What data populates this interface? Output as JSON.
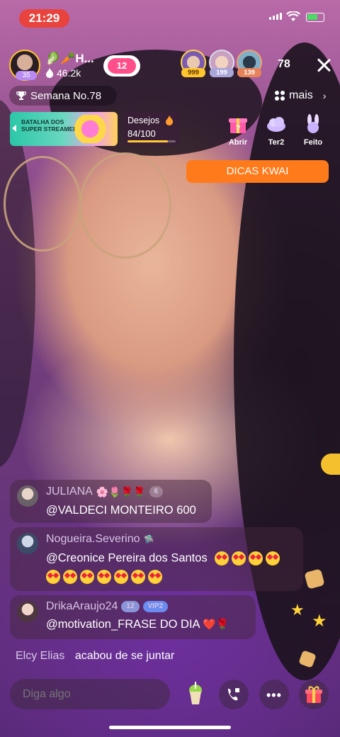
{
  "status_bar": {
    "time": "21:29"
  },
  "host": {
    "name": "🥬🥕H...",
    "likes": "46.2k",
    "level": "35",
    "heart_level": "12"
  },
  "viewers": {
    "badges": [
      "999",
      "199",
      "139"
    ],
    "count": "78"
  },
  "week": {
    "label": "Semana No.78"
  },
  "more": {
    "label": "mais"
  },
  "battle_banner": {
    "text": "BATALHA DOS SUPER STREAMERS"
  },
  "wishes": {
    "title": "Desejos",
    "value": "84/100",
    "progress": 0.84
  },
  "actions": [
    {
      "label": "Abrir",
      "icon": "mystery-gift-icon"
    },
    {
      "label": "Ter2",
      "icon": "cloud-icon"
    },
    {
      "label": "Feito",
      "icon": "bunny-icon"
    }
  ],
  "tips_button": {
    "label": "DICAS KWAI"
  },
  "chat": [
    {
      "user": "JULIANA",
      "badge": "6",
      "message": "@VALDECI MONTEIRO 600"
    },
    {
      "user": "Nogueira.Severino",
      "message": "@Creonice Pereira dos Santos"
    },
    {
      "user": "DrikaAraujo24",
      "badge": "12",
      "vip": "VIP2",
      "message": "@motivation_FRASE DO DIA"
    }
  ],
  "join_notice": {
    "user": "Elcy Elias",
    "text": "acabou de se juntar"
  },
  "input": {
    "placeholder": "Diga algo"
  },
  "colors": {
    "accent_orange": "#ff7a1a",
    "status_red": "#e8433d",
    "heart_pink": "#ff4f8b"
  }
}
